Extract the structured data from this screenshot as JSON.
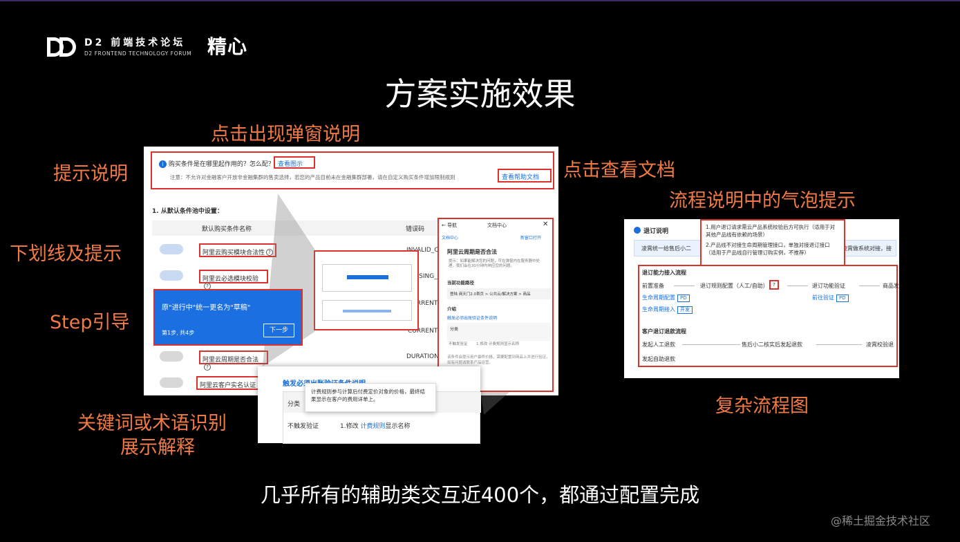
{
  "header": {
    "brand_title": "D2 前端技术论坛",
    "brand_sub": "D2 FRONTEND TECHNOLOGY FORUM",
    "speaker_mark": "精心"
  },
  "title": "方案实施效果",
  "labels": {
    "popup_explain": "点击出现弹窗说明",
    "hint_explain": "提示说明",
    "view_doc": "点击查看文档",
    "bubble_tip": "流程说明中的气泡提示",
    "underline_tip": "下划线及提示",
    "step_guide": "Step引导",
    "keyword_a": "关键词或术语识别",
    "keyword_b": "展示解释",
    "complex_flow": "复杂流程图"
  },
  "bottom_text": "几乎所有的辅助类交互近400个，都通过配置完成",
  "watermark": "@稀土掘金技术社区",
  "panel": {
    "notice_question": "购买条件是在哪里起作用的？怎么配？",
    "notice_link": "查看图示",
    "notice_note": "注意：不允许对金融客户开放非金融集群的售卖选择，若您的产品目前未在金融集群部署，请在自定义购买条件增加限制规则",
    "help_doc": "查看帮助文档",
    "section_title": "1. 从默认条件池中设置：",
    "col_name": "默认购买条件名称",
    "col_code": "错误码",
    "rows": [
      {
        "name": "阿里云购买模块合法性",
        "code": "INVALID_CO"
      },
      {
        "name": "阿里云必选模块校验",
        "code": "MISSING_NE"
      },
      {
        "name": "",
        "code": "CURRENT_U"
      },
      {
        "name": "",
        "code": "CURRENT_O"
      },
      {
        "name": "阿里云周期是否合法",
        "code": "DURATION_I"
      },
      {
        "name": "阿里云客户实名认证",
        "code": ""
      }
    ]
  },
  "step": {
    "text": "原\"进行中\"统一更名为\"草稿\"",
    "progress": "第1步, 共4步",
    "next": "下一步"
  },
  "doc": {
    "back": "← 导航",
    "center": "文档中心",
    "crumb": "文档中心",
    "open_new": "新窗口打开",
    "heading": "阿里云周期是否合法",
    "tip": "提示：如果能解决您的问题，可在弹窗内在服务器中处理，我们会在30分钟内响应您的问题。",
    "path_title": "当前功能路径",
    "path": "登陆 商天门2.0首页 > 公共云/解决方案 > 商品",
    "intro": "介绍",
    "link": "触发必须出账验证条件说明",
    "cat": "分类",
    "cat_value": "不触发验证",
    "cat_rule": "1.修改 计费规则显示名称",
    "body": "该条件会提示用户最终价格，需要配置到商品上并进行验证，如有问题请联系产品运营。"
  },
  "popup": {
    "title": "触发必须出账验证条件说明",
    "tip": "计费规则参与计算后付费定价对象的价格，最终结果显示在客户的费用详单上。",
    "col_cat": "分类",
    "cell_cat": "不触发验证",
    "cell_rule_prefix": "1.修改 ",
    "cell_rule_link": "计费规则",
    "cell_rule_suffix": "显示名称"
  },
  "rpanel": {
    "title": "退订说明",
    "banner": "凌霄统一给售后小二",
    "banner_right": "凌霄做系统对接，接",
    "bubble_1": "1.用户退订请求需云产品系统校验后方可执行（适用于对其他产品线有依赖的场景）",
    "bubble_2": "2.产品线不对接生命周期管理接口，单独对接退订接口（适用于产品线自行管理订购实例，不推荐）",
    "flow1_title": "退订能力接入流程",
    "flow1_steps": [
      "前置准备",
      "退订规则配置（人工/自助）",
      "退订功能验证",
      "商品发"
    ],
    "flow1_links": [
      "生命周期配置",
      "生命周期接入",
      "前往验证"
    ],
    "tag_pd": "PD",
    "tag_dev": "开发",
    "flow2_title": "客户退订退款流程",
    "flow2_steps": [
      "发起人工退款",
      "售后小二核实后发起退款",
      "凌霄校验退"
    ],
    "flow2_auto": "发起自助退款"
  }
}
